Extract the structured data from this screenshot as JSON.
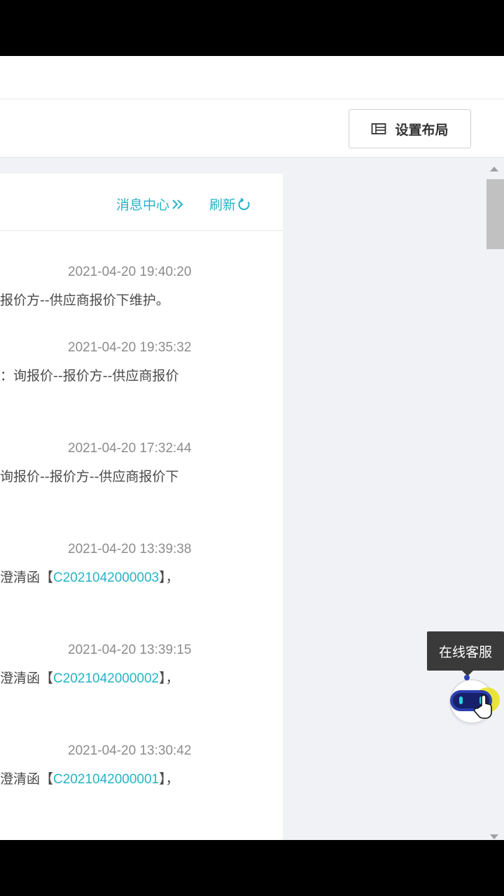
{
  "toolbar": {
    "layout_label": "设置布局",
    "layout_icon": "layout-icon"
  },
  "panel": {
    "message_center_label": "消息中心",
    "refresh_label": "刷新",
    "messages": [
      {
        "time": "2021-04-20 19:40:20",
        "text": "报价方--供应商报价下维护。",
        "code": "",
        "suffix": ""
      },
      {
        "time": "2021-04-20 19:35:32",
        "text": "：询报价--报价方--供应商报价",
        "code": "",
        "suffix": ""
      },
      {
        "time": "2021-04-20 17:32:44",
        "text": "询报价--报价方--供应商报价下",
        "code": "",
        "suffix": ""
      },
      {
        "time": "2021-04-20 13:39:38",
        "text": "澄清函【",
        "code": "C2021042000003",
        "suffix": "】，"
      },
      {
        "time": "2021-04-20 13:39:15",
        "text": "澄清函【",
        "code": "C2021042000002",
        "suffix": "】，"
      },
      {
        "time": "2021-04-20 13:30:42",
        "text": "澄清函【",
        "code": "C2021042000001",
        "suffix": "】，"
      }
    ]
  },
  "support": {
    "tooltip": "在线客服",
    "icon": "robot-icon"
  },
  "colors": {
    "accent": "#26b3c6",
    "tooltip_bg": "#3a3a3a"
  }
}
